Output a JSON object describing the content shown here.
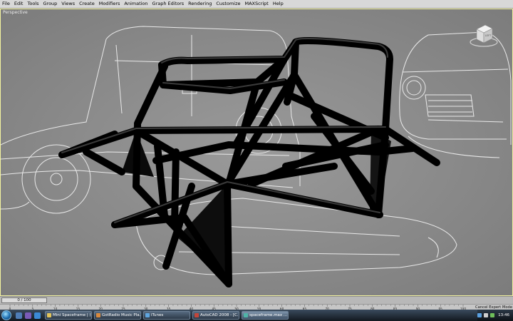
{
  "menu": [
    "File",
    "Edit",
    "Tools",
    "Group",
    "Views",
    "Create",
    "Modifiers",
    "Animation",
    "Graph Editors",
    "Rendering",
    "Customize",
    "MAXScript",
    "Help"
  ],
  "viewport": {
    "label": "Perspective"
  },
  "viewcube": {
    "face_label": "LEFT"
  },
  "timeline": {
    "frame_display": "0 / 100",
    "ticks": [
      "0",
      "5",
      "10",
      "15",
      "20",
      "25",
      "30",
      "35",
      "40",
      "45",
      "50",
      "55",
      "60",
      "65",
      "70",
      "75",
      "80",
      "85",
      "90",
      "95",
      "100"
    ]
  },
  "prompt": {
    "cancel_label": "Cancel Expert Mode"
  },
  "taskbar": {
    "tasks": [
      {
        "label": "Mini Spaceframe | (C...",
        "color": "#e2c35a",
        "active": false
      },
      {
        "label": "GotRadio Music Pla...",
        "color": "#d9893d",
        "active": false
      },
      {
        "label": "iTunes",
        "color": "#5fa6e0",
        "active": false
      },
      {
        "label": "AutoCAD 2008 - [C...",
        "color": "#c2463a",
        "active": false
      },
      {
        "label": "spaceframe.max ...",
        "color": "#4fb4a8",
        "active": true
      }
    ],
    "clock": "13:46"
  }
}
